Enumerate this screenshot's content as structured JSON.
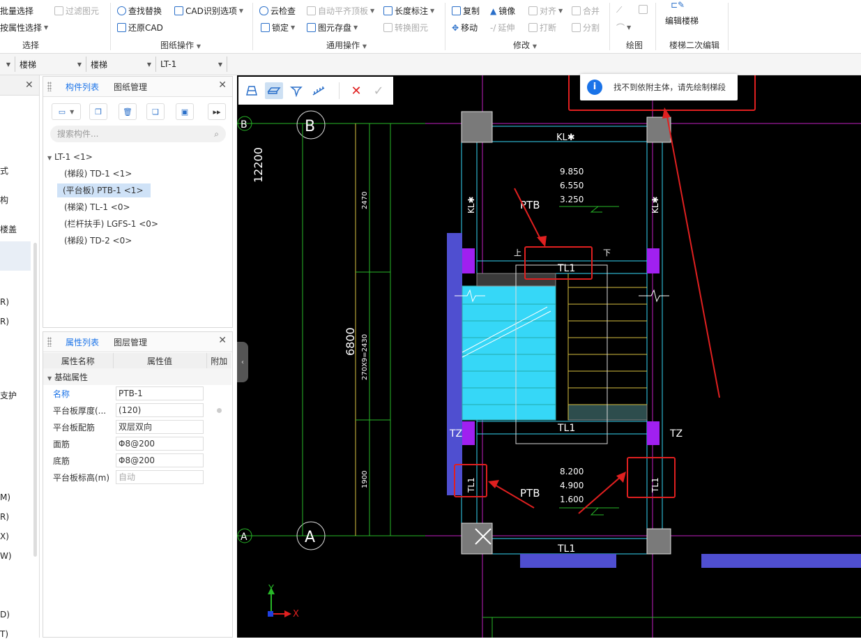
{
  "ribbon": {
    "select_group": {
      "batch_select": "批量选择",
      "filter_element": "过滤图元",
      "attr_select": "按属性选择",
      "title": "选择"
    },
    "drawing_group": {
      "find_replace": "查找替换",
      "cad_options": "CAD识别选项",
      "restore_cad": "还原CAD",
      "title": "图纸操作"
    },
    "common_group": {
      "cloud_check": "云检查",
      "auto_align_top": "自动平齐顶板",
      "length_dim": "长度标注",
      "lock": "锁定",
      "save_element": "图元存盘",
      "convert_element": "转换图元",
      "title": "通用操作"
    },
    "modify_group": {
      "copy": "复制",
      "mirror": "镜像",
      "align": "对齐",
      "merge": "合并",
      "move": "移动",
      "extend": "延伸",
      "break": "打断",
      "split": "分割",
      "title": "修改"
    },
    "draw_group": {
      "title": "绘图"
    },
    "stair_group": {
      "edit_stair": "编辑楼梯",
      "title": "楼梯二次编辑"
    }
  },
  "toolbar2": {
    "selects": [
      {
        "value": "楼梯"
      },
      {
        "value": "楼梯"
      },
      {
        "value": "LT-1"
      }
    ]
  },
  "left_strip": {
    "items": [
      "式",
      "构",
      "楼盖",
      "R)",
      "R)",
      "支护",
      "M)",
      "R)",
      "X)",
      "W)",
      "D)",
      "T)"
    ]
  },
  "component_panel": {
    "tab_components": "构件列表",
    "tab_drawings": "图纸管理",
    "search_placeholder": "搜索构件...",
    "tree": [
      {
        "label": "LT-1 <1>",
        "level": 0,
        "selected": false
      },
      {
        "label": "(梯段) TD-1 <1>",
        "level": 1,
        "selected": false
      },
      {
        "label": "(平台板) PTB-1 <1>",
        "level": 1,
        "selected": true
      },
      {
        "label": "(梯梁) TL-1 <0>",
        "level": 1,
        "selected": false
      },
      {
        "label": "(栏杆扶手) LGFS-1 <0>",
        "level": 1,
        "selected": false
      },
      {
        "label": "(梯段) TD-2 <0>",
        "level": 1,
        "selected": false
      }
    ]
  },
  "property_panel": {
    "tab_props": "属性列表",
    "tab_layers": "图层管理",
    "col_name": "属性名称",
    "col_value": "属性值",
    "col_extra": "附加",
    "group_basic": "基础属性",
    "rows": [
      {
        "name": "名称",
        "value": "PTB-1",
        "highlight": true,
        "gray": false
      },
      {
        "name": "平台板厚度(...",
        "value": "(120)",
        "highlight": false,
        "gray": false
      },
      {
        "name": "平台板配筋",
        "value": "双层双向",
        "highlight": false,
        "gray": false
      },
      {
        "name": "面筋",
        "value": "Φ8@200",
        "highlight": false,
        "gray": false
      },
      {
        "name": "底筋",
        "value": "Φ8@200",
        "highlight": false,
        "gray": false
      },
      {
        "name": "平台板标高(m)",
        "value": "自动",
        "highlight": false,
        "gray": true
      }
    ]
  },
  "toast": {
    "message": "找不到依附主体，请先绘制梯段"
  },
  "cad": {
    "axis_b": "B",
    "axis_a": "A",
    "dim_12200": "12200",
    "dim_6800": "6800",
    "dim_2470": "2470",
    "dim_270x9": "270X9=2430",
    "dim_1900": "1900",
    "kl_top": "KL✱",
    "kl_left": "KL✱",
    "kl_right": "KL✱",
    "ptb_top": "PTB",
    "ptb_bottom": "PTB",
    "elev_top": [
      "9.850",
      "6.550",
      "3.250"
    ],
    "elev_bottom": [
      "8.200",
      "4.900",
      "1.600"
    ],
    "tl1_top": "TL1",
    "tl1_mid": "TL1",
    "tl1_bottom": "TL1",
    "tl1_left": "TL1",
    "tl1_right": "TL1",
    "tz_left": "TZ",
    "tz_right": "TZ",
    "up": "上",
    "down": "下",
    "axis_y": "Y",
    "axis_x": "X"
  },
  "colors": {
    "accent": "#1a73e8",
    "highlight_red": "#e02020",
    "cad_cyan": "#36d7f7",
    "cad_column": "#7a7a7a",
    "cad_purple": "#a020f0",
    "cad_blue_slab": "#4f4fd0"
  }
}
